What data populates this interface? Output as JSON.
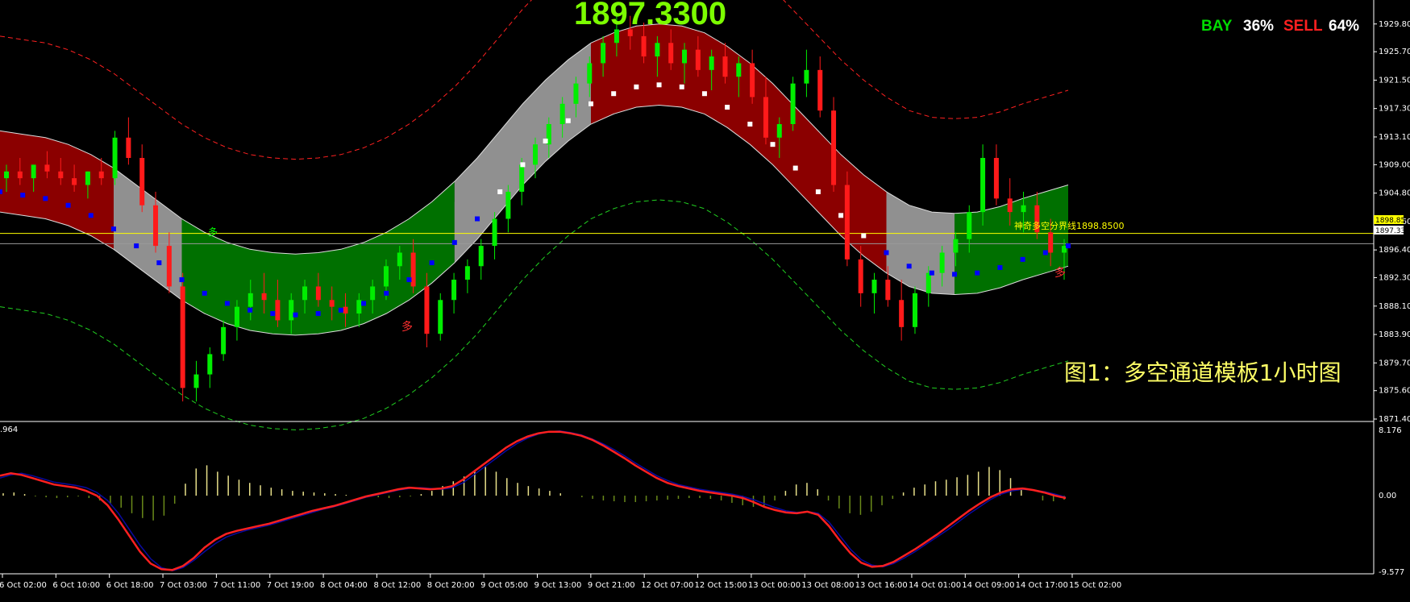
{
  "header": {
    "big_price": "1897.3300",
    "bay_label": "BAY",
    "bay_pct": "36%",
    "sell_label": "SELL",
    "sell_pct": "64%"
  },
  "overlay_text": "图1：多空通道模板1小时图",
  "ref_line": {
    "label": "神奇多空分界线1898.8500",
    "value": 1898.85
  },
  "price_tags": {
    "ref": "1898.85",
    "current": "1897.33"
  },
  "colors": {
    "background": "#000000",
    "bull_channel": "#007000",
    "bear_channel": "#8b0000",
    "neutral_channel": "#909090",
    "up_candle": "#00ee00",
    "down_candle": "#ff1a1a",
    "signal_down": "#0000ff",
    "signal_up": "#ffffff",
    "macd_line": "#ff2020",
    "signal_line": "#0a0aa0",
    "hist_pos": "#e8e08a",
    "hist_neg": "#6a8a1a",
    "ref_line": "#ffff00",
    "accent_magenta": "#ff00ff"
  },
  "signals": [
    "多",
    "多",
    "多"
  ],
  "chart_data": [
    {
      "type": "candlestick",
      "title": "",
      "ylim": [
        1871.4,
        1931.2
      ],
      "yticks": [
        "1929.80",
        "1925.70",
        "1921.50",
        "1917.30",
        "1913.10",
        "1909.00",
        "1904.80",
        "1900.60",
        "1896.40",
        "1892.30",
        "1888.10",
        "1883.90",
        "1879.70",
        "1875.60",
        "1871.40"
      ],
      "xticks": [
        "6 Oct 02:00",
        "6 Oct 10:00",
        "6 Oct 18:00",
        "7 Oct 03:00",
        "7 Oct 11:00",
        "7 Oct 19:00",
        "8 Oct 04:00",
        "8 Oct 12:00",
        "8 Oct 20:00",
        "9 Oct 05:00",
        "9 Oct 13:00",
        "9 Oct 21:00",
        "12 Oct 07:00",
        "12 Oct 15:00",
        "13 Oct 00:00",
        "13 Oct 08:00",
        "13 Oct 16:00",
        "14 Oct 01:00",
        "14 Oct 09:00",
        "14 Oct 17:00",
        "15 Oct 02:00"
      ],
      "midline": [
        1908,
        1907.5,
        1907,
        1906,
        1904.5,
        1902.5,
        1900,
        1897.5,
        1895,
        1893,
        1891.5,
        1890.5,
        1890,
        1889.8,
        1890,
        1890.5,
        1891.5,
        1893,
        1895,
        1897.5,
        1900.5,
        1904,
        1908,
        1912,
        1915.5,
        1918.5,
        1921,
        1922.5,
        1923.5,
        1923.8,
        1923.5,
        1922.5,
        1920.5,
        1918,
        1915,
        1911.5,
        1908,
        1904.5,
        1901.5,
        1899,
        1897,
        1896,
        1895.8,
        1896,
        1896.8,
        1898,
        1899,
        1900
      ],
      "channel_width": 6,
      "outer_width": 20,
      "candles_note": "price series approx; each candle o,h,l,c",
      "candles": [
        [
          1907,
          1909,
          1905,
          1908
        ],
        [
          1908,
          1910,
          1906,
          1907
        ],
        [
          1907,
          1909,
          1905,
          1909
        ],
        [
          1909,
          1911,
          1907,
          1908
        ],
        [
          1908,
          1910,
          1906,
          1907
        ],
        [
          1907,
          1909,
          1905,
          1906
        ],
        [
          1906,
          1908,
          1904,
          1908
        ],
        [
          1908,
          1910,
          1906,
          1907
        ],
        [
          1907,
          1914,
          1906,
          1913
        ],
        [
          1913,
          1916,
          1909,
          1910
        ],
        [
          1910,
          1912,
          1902,
          1903
        ],
        [
          1903,
          1905,
          1896,
          1897
        ],
        [
          1897,
          1899,
          1890,
          1891
        ],
        [
          1891,
          1893,
          1874,
          1876
        ],
        [
          1876,
          1880,
          1874,
          1878
        ],
        [
          1878,
          1882,
          1876,
          1881
        ],
        [
          1881,
          1886,
          1880,
          1885
        ],
        [
          1885,
          1889,
          1883,
          1888
        ],
        [
          1888,
          1892,
          1886,
          1890
        ],
        [
          1890,
          1893,
          1887,
          1889
        ],
        [
          1889,
          1892,
          1885,
          1886
        ],
        [
          1886,
          1890,
          1884,
          1889
        ],
        [
          1889,
          1892,
          1887,
          1891
        ],
        [
          1891,
          1893,
          1888,
          1889
        ],
        [
          1889,
          1891,
          1886,
          1888
        ],
        [
          1888,
          1890,
          1885,
          1887
        ],
        [
          1887,
          1890,
          1885,
          1889
        ],
        [
          1889,
          1892,
          1887,
          1891
        ],
        [
          1891,
          1895,
          1889,
          1894
        ],
        [
          1894,
          1897,
          1892,
          1896
        ],
        [
          1896,
          1898,
          1890,
          1891
        ],
        [
          1891,
          1893,
          1882,
          1884
        ],
        [
          1884,
          1890,
          1883,
          1889
        ],
        [
          1889,
          1893,
          1887,
          1892
        ],
        [
          1892,
          1895,
          1890,
          1894
        ],
        [
          1894,
          1898,
          1892,
          1897
        ],
        [
          1897,
          1902,
          1895,
          1901
        ],
        [
          1901,
          1906,
          1899,
          1905
        ],
        [
          1905,
          1910,
          1903,
          1909
        ],
        [
          1909,
          1913,
          1907,
          1912
        ],
        [
          1912,
          1916,
          1910,
          1915
        ],
        [
          1915,
          1919,
          1913,
          1918
        ],
        [
          1918,
          1922,
          1916,
          1921
        ],
        [
          1921,
          1925,
          1919,
          1924
        ],
        [
          1924,
          1928,
          1922,
          1927
        ],
        [
          1927,
          1931,
          1925,
          1929
        ],
        [
          1929,
          1931,
          1926,
          1928
        ],
        [
          1928,
          1930,
          1924,
          1925
        ],
        [
          1925,
          1928,
          1922,
          1927
        ],
        [
          1927,
          1929,
          1923,
          1924
        ],
        [
          1924,
          1927,
          1921,
          1926
        ],
        [
          1926,
          1928,
          1922,
          1923
        ],
        [
          1923,
          1926,
          1920,
          1925
        ],
        [
          1925,
          1927,
          1921,
          1922
        ],
        [
          1922,
          1925,
          1919,
          1924
        ],
        [
          1924,
          1926,
          1918,
          1919
        ],
        [
          1919,
          1922,
          1912,
          1913
        ],
        [
          1913,
          1916,
          1910,
          1915
        ],
        [
          1915,
          1922,
          1914,
          1921
        ],
        [
          1921,
          1926,
          1919,
          1923
        ],
        [
          1923,
          1925,
          1916,
          1917
        ],
        [
          1917,
          1919,
          1905,
          1906
        ],
        [
          1906,
          1908,
          1894,
          1895
        ],
        [
          1895,
          1897,
          1888,
          1890
        ],
        [
          1890,
          1893,
          1887,
          1892
        ],
        [
          1892,
          1894,
          1888,
          1889
        ],
        [
          1889,
          1892,
          1883,
          1885
        ],
        [
          1885,
          1891,
          1884,
          1890
        ],
        [
          1890,
          1894,
          1888,
          1893
        ],
        [
          1893,
          1897,
          1891,
          1896
        ],
        [
          1896,
          1899,
          1894,
          1898
        ],
        [
          1898,
          1903,
          1896,
          1902
        ],
        [
          1902,
          1912,
          1900,
          1910
        ],
        [
          1910,
          1912,
          1903,
          1904
        ],
        [
          1904,
          1907,
          1900,
          1902
        ],
        [
          1902,
          1905,
          1899,
          1903
        ],
        [
          1903,
          1905,
          1898,
          1899
        ],
        [
          1899,
          1901,
          1894,
          1896
        ],
        [
          1896,
          1898,
          1892,
          1897
        ]
      ]
    },
    {
      "type": "line",
      "title": "",
      "yticks": [
        "8.176",
        "0.00",
        "-9.577"
      ],
      "ylim": [
        -9.577,
        8.176
      ],
      "top_left_value": ".964",
      "series": [
        {
          "values": [
            2.5,
            2.8,
            2.6,
            2.2,
            1.8,
            1.4,
            1.2,
            1.0,
            0.6,
            0.0,
            -1.2,
            -3.0,
            -5.0,
            -7.0,
            -8.5,
            -9.2,
            -9.3,
            -8.8,
            -7.8,
            -6.5,
            -5.5,
            -4.8,
            -4.4,
            -4.1,
            -3.8,
            -3.5,
            -3.1,
            -2.7,
            -2.3,
            -1.9,
            -1.6,
            -1.3,
            -0.9,
            -0.5,
            -0.1,
            0.2,
            0.5,
            0.8,
            1.0,
            0.9,
            0.8,
            0.9,
            1.2,
            2.0,
            3.0,
            4.0,
            5.0,
            6.0,
            6.8,
            7.4,
            7.8,
            8.0,
            8.0,
            7.8,
            7.5,
            7.0,
            6.3,
            5.5,
            4.7,
            3.8,
            3.0,
            2.2,
            1.6,
            1.2,
            0.9,
            0.6,
            0.4,
            0.2,
            0.0,
            -0.3,
            -0.8,
            -1.4,
            -1.8,
            -2.1,
            -2.2,
            -2.0,
            -2.4,
            -3.8,
            -5.6,
            -7.2,
            -8.4,
            -8.9,
            -8.8,
            -8.3,
            -7.5,
            -6.7,
            -5.8,
            -4.9,
            -3.9,
            -2.9,
            -1.9,
            -1.0,
            -0.2,
            0.4,
            0.8,
            0.9,
            0.7,
            0.4,
            0.0,
            -0.3
          ]
        },
        {
          "values": [
            2.2,
            2.6,
            2.8,
            2.5,
            2.1,
            1.7,
            1.5,
            1.3,
            1.0,
            0.4,
            -0.6,
            -2.2,
            -4.2,
            -6.2,
            -7.9,
            -9.0,
            -9.4,
            -9.0,
            -8.1,
            -7.0,
            -6.0,
            -5.2,
            -4.7,
            -4.3,
            -4.0,
            -3.7,
            -3.3,
            -2.9,
            -2.5,
            -2.1,
            -1.7,
            -1.4,
            -1.0,
            -0.6,
            -0.2,
            0.1,
            0.4,
            0.7,
            0.9,
            1.0,
            0.9,
            0.8,
            1.0,
            1.6,
            2.6,
            3.6,
            4.6,
            5.6,
            6.5,
            7.2,
            7.7,
            8.0,
            8.1,
            7.9,
            7.6,
            7.1,
            6.5,
            5.8,
            5.0,
            4.1,
            3.3,
            2.5,
            1.9,
            1.4,
            1.1,
            0.8,
            0.6,
            0.4,
            0.2,
            -0.1,
            -0.5,
            -1.0,
            -1.5,
            -1.9,
            -2.1,
            -2.0,
            -2.2,
            -3.3,
            -5.0,
            -6.7,
            -8.0,
            -8.7,
            -8.9,
            -8.5,
            -7.8,
            -7.0,
            -6.1,
            -5.2,
            -4.3,
            -3.3,
            -2.3,
            -1.4,
            -0.5,
            0.2,
            0.6,
            0.8,
            0.7,
            0.5,
            0.2,
            -0.2
          ]
        }
      ],
      "histogram": [
        0.3,
        0.4,
        0.2,
        -0.1,
        -0.2,
        -0.3,
        -0.2,
        -0.1,
        -0.3,
        -0.6,
        -1.0,
        -1.5,
        -2.2,
        -2.8,
        -3.1,
        -2.5,
        -1.0,
        1.5,
        3.4,
        3.8,
        3.0,
        2.5,
        2.0,
        1.6,
        1.3,
        1.0,
        0.8,
        0.6,
        0.5,
        0.4,
        0.3,
        0.2,
        0.1,
        0.0,
        -0.1,
        -0.2,
        -0.3,
        -0.2,
        -0.1,
        0.2,
        0.6,
        1.2,
        1.8,
        2.4,
        3.2,
        3.6,
        3.0,
        2.2,
        1.6,
        1.2,
        0.9,
        0.6,
        0.3,
        0.0,
        -0.2,
        -0.4,
        -0.6,
        -0.7,
        -0.8,
        -0.8,
        -0.7,
        -0.6,
        -0.5,
        -0.4,
        -0.3,
        -0.3,
        -0.4,
        -0.6,
        -0.9,
        -1.2,
        -1.4,
        -1.3,
        -0.6,
        0.6,
        1.4,
        1.6,
        0.8,
        -0.6,
        -1.6,
        -2.2,
        -2.4,
        -2.0,
        -1.2,
        -0.4,
        0.4,
        1.0,
        1.4,
        1.8,
        2.0,
        2.3,
        2.6,
        3.0,
        3.6,
        3.2,
        2.2,
        1.0,
        0.0,
        -0.6,
        -0.7,
        -0.5
      ]
    }
  ]
}
